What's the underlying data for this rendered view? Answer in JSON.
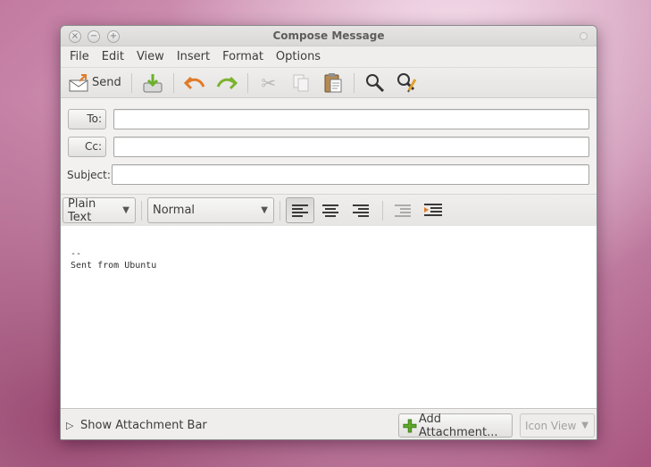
{
  "window": {
    "title": "Compose Message"
  },
  "menu": {
    "items": [
      "File",
      "Edit",
      "View",
      "Insert",
      "Format",
      "Options"
    ]
  },
  "toolbar": {
    "send_label": "Send",
    "icons": [
      "send-icon",
      "save-draft-icon",
      "undo-icon",
      "redo-icon",
      "cut-icon",
      "copy-icon",
      "paste-icon",
      "find-icon",
      "find-replace-icon"
    ]
  },
  "header": {
    "to_label": "To:",
    "cc_label": "Cc:",
    "subject_label": "Subject:",
    "to_value": "",
    "cc_value": "",
    "subject_value": ""
  },
  "format": {
    "mode": "Plain Text",
    "paragraph_style": "Normal"
  },
  "editor": {
    "signature_sep": "--",
    "signature_text": "Sent from Ubuntu"
  },
  "attachments": {
    "show_bar_label": "Show Attachment Bar",
    "add_label": "Add Attachment...",
    "view_mode": "Icon View"
  },
  "colors": {
    "undo": "#e07b29",
    "redo": "#7bb32e",
    "add_icon": "#5ea82a"
  }
}
